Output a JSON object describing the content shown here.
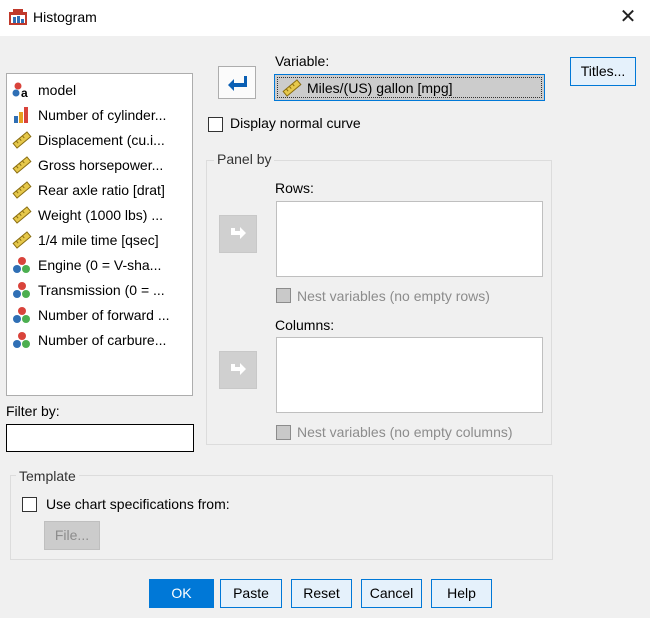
{
  "window": {
    "title": "Histogram",
    "close_icon": "close-icon"
  },
  "variables_list": [
    {
      "label": "model",
      "icon": "nominal-string-icon"
    },
    {
      "label": "Number of cylinder...",
      "icon": "ordinal-icon"
    },
    {
      "label": "Displacement (cu.i...",
      "icon": "scale-ruler-icon"
    },
    {
      "label": "Gross horsepower...",
      "icon": "scale-ruler-icon"
    },
    {
      "label": "Rear axle ratio [drat]",
      "icon": "scale-ruler-icon"
    },
    {
      "label": "Weight (1000 lbs) ...",
      "icon": "scale-ruler-icon"
    },
    {
      "label": "1/4 mile time [qsec]",
      "icon": "scale-ruler-icon"
    },
    {
      "label": "Engine (0 = V-sha...",
      "icon": "nominal-icon"
    },
    {
      "label": "Transmission (0 = ...",
      "icon": "nominal-icon"
    },
    {
      "label": "Number of forward ...",
      "icon": "nominal-icon"
    },
    {
      "label": "Number of carbure...",
      "icon": "nominal-icon"
    }
  ],
  "filter": {
    "label": "Filter by:",
    "value": ""
  },
  "variable": {
    "label": "Variable:",
    "value": "Miles/(US) gallon [mpg]"
  },
  "titles_button": "Titles...",
  "display_normal_curve": {
    "label": "Display normal curve",
    "checked": false
  },
  "panel_by": {
    "legend": "Panel by",
    "rows_label": "Rows:",
    "nest_rows_label": "Nest variables (no empty rows)",
    "columns_label": "Columns:",
    "nest_columns_label": "Nest variables (no empty columns)"
  },
  "template": {
    "legend": "Template",
    "use_chart_label": "Use chart specifications from:",
    "file_button": "File..."
  },
  "buttons": {
    "ok": "OK",
    "paste": "Paste",
    "reset": "Reset",
    "cancel": "Cancel",
    "help": "Help"
  },
  "colors": {
    "accent": "#0078d7",
    "dialog_bg": "#f0f0f0",
    "selected_field": "#cccccc"
  }
}
